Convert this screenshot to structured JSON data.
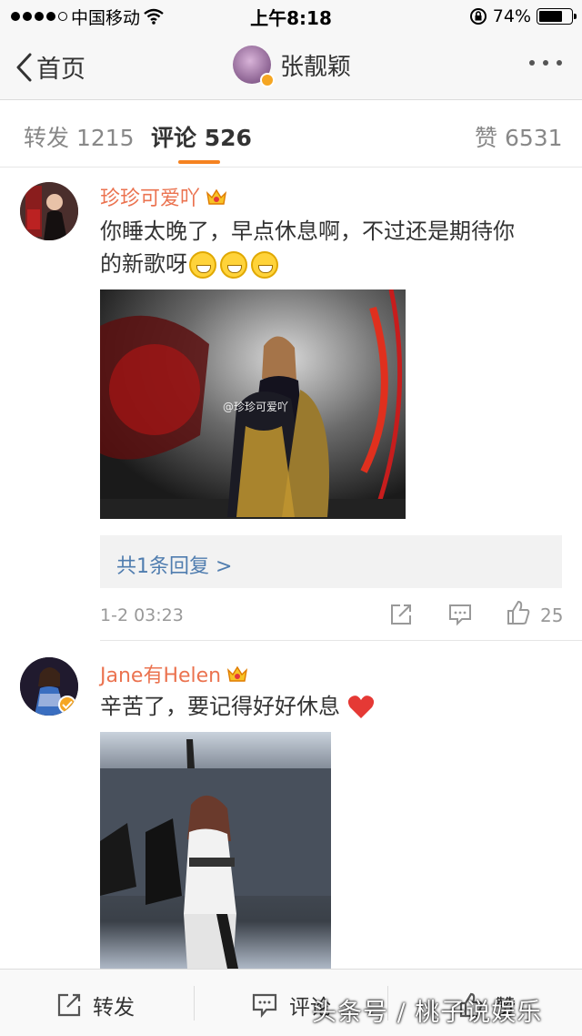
{
  "status_bar": {
    "carrier": "中国移动",
    "time": "上午8:18",
    "battery": "74%",
    "battery_level": 0.74
  },
  "nav": {
    "back_label": "首页",
    "title": "张靓颖"
  },
  "tabs": [
    {
      "label": "转发 1215"
    },
    {
      "label": "评论 526"
    },
    {
      "label": "赞 6531"
    }
  ],
  "comments": [
    {
      "username": "珍珍可爱吖",
      "text_line1": "你睡太晚了，早点休息啊，不过还是期待你",
      "text_line2": "的新歌呀",
      "photo_watermark": "@珍珍可爱吖",
      "reply_link": "共1条回复 >",
      "time": "1-2 03:23",
      "likes": "25"
    },
    {
      "username": "Jane有Helen",
      "text": "辛苦了，要记得好好休息"
    }
  ],
  "bottom_bar": {
    "repost": "转发",
    "comment": "评论",
    "like": "赞"
  },
  "watermark": "头条号 / 桃子说娱乐",
  "colors": {
    "accent": "#f58220",
    "username": "#eb7350",
    "link": "#507daf"
  }
}
